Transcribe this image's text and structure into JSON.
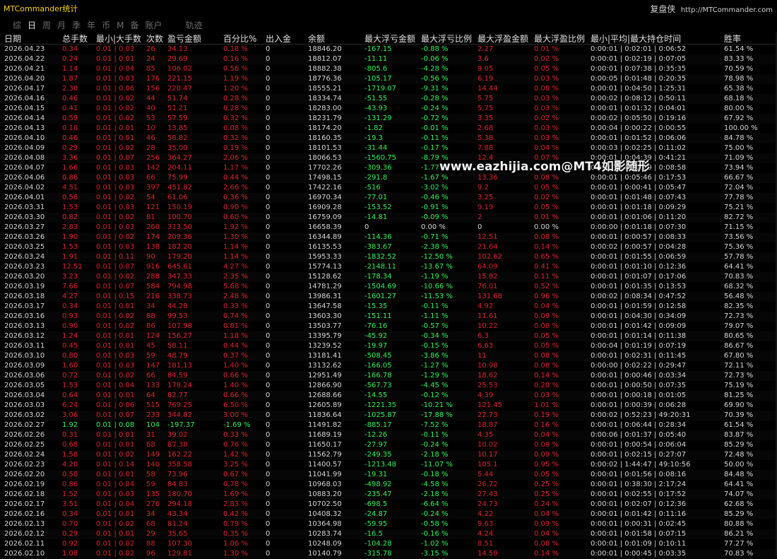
{
  "app": {
    "title": "MTCommander统计",
    "brand_cn": "复盘侠",
    "brand_url": "http://MTCommander.com"
  },
  "tabs": [
    "综",
    "日",
    "周",
    "月",
    "季",
    "年",
    "币",
    "M",
    "备",
    "账户",
    "轨迹"
  ],
  "active_tab": "日",
  "columns": [
    "日期",
    "总手数",
    "最小|大手数",
    "次数",
    "盈亏金额",
    "百分比%",
    "出入金",
    "余额",
    "最大浮亏金额",
    "最大浮亏比例",
    "最大浮盈金额",
    "最大浮盈比例",
    "最小|平均|最大持仓时间",
    "胜率"
  ],
  "watermark": "www.eazhijia.com@MT4如影随形",
  "colors": {
    "loss": "#e0202a",
    "profit": "#2ef25a",
    "neutral": "#d6d6d6"
  },
  "rows": [
    [
      "2026.04.23",
      "0.34",
      "0.01 | 0.03",
      "26",
      "34.13",
      "0.18 %",
      "0",
      "18846.20",
      "-167.15",
      "-0.88 %",
      "2.27",
      "0.01 %",
      "0:00:01 | 0:02:01 | 0:06:52",
      "61.54 %"
    ],
    [
      "2026.04.22",
      "0.24",
      "0.01 | 0.01",
      "24",
      "29.69",
      "0.16 %",
      "0",
      "18812.07",
      "-11.11",
      "-0.06 %",
      "3.6",
      "0.02 %",
      "0:00:01 | 0:02:19 | 0:07:05",
      "83.33 %"
    ],
    [
      "2026.04.21",
      "1.14",
      "0.01 | 0.04",
      "85",
      "106.02",
      "0.56 %",
      "0",
      "18882.38",
      "-805.6",
      "-4.28 %",
      "9.05",
      "0.05 %",
      "0:00:01 | 0:07:38 | 0:35:35",
      "70.59 %"
    ],
    [
      "2026.04.20",
      "1.87",
      "0.01 | 0.03",
      "176",
      "221.15",
      "1.19 %",
      "0",
      "18776.36",
      "-105.17",
      "-0.56 %",
      "6.19",
      "0.03 %",
      "0:00:05 | 0:01:48 | 0:20:35",
      "78.98 %"
    ],
    [
      "2026.04.17",
      "2.30",
      "0.01 | 0.06",
      "156",
      "220.47",
      "1.20 %",
      "0",
      "18555.21",
      "-1719.07",
      "-9.31 %",
      "14.44",
      "0.08 %",
      "0:00:01 | 0:04:50 | 1:25:31",
      "65.38 %"
    ],
    [
      "2026.04.16",
      "0.46",
      "0.01 | 0.02",
      "44",
      "51.74",
      "0.28 %",
      "0",
      "18334.74",
      "-51.55",
      "-0.28 %",
      "5.75",
      "0.03 %",
      "0:00:02 | 0:08:12 | 0:50:11",
      "68.18 %"
    ],
    [
      "2026.04.15",
      "0.41",
      "0.01 | 0.02",
      "40",
      "51.21",
      "0.28 %",
      "0",
      "18283.00",
      "-43.93",
      "-0.24 %",
      "5.75",
      "0.03 %",
      "0:00:01 | 0:01:32 | 0:04:01",
      "80.00 %"
    ],
    [
      "2026.04.14",
      "0.59",
      "0.01 | 0.02",
      "53",
      "57.59",
      "0.32 %",
      "0",
      "18231.79",
      "-131.29",
      "-0.72 %",
      "3.35",
      "0.02 %",
      "0:00:02 | 0:05:50 | 0:19:16",
      "67.92 %"
    ],
    [
      "2026.04.13",
      "0.10",
      "0.01 | 0.01",
      "10",
      "13.85",
      "0.08 %",
      "0",
      "18174.20",
      "-1.82",
      "-0.01 %",
      "2.68",
      "0.03 %",
      "0:00:04 | 0:00:22 | 0:00:55",
      "100.00 %"
    ],
    [
      "2026.04.10",
      "0.46",
      "0.01 | 0.01",
      "46",
      "58.82",
      "0.32 %",
      "0",
      "18160.35",
      "-19.3",
      "-0.11 %",
      "5.38",
      "0.03 %",
      "0:00:01 | 0:01:52 | 0:06:06",
      "84.78 %"
    ],
    [
      "2026.04.09",
      "0.29",
      "0.01 | 0.02",
      "28",
      "35.00",
      "0.19 %",
      "0",
      "18101.53",
      "-31.44",
      "-0.17 %",
      "7.88",
      "0.04 %",
      "0:00:03 | 0:02:25 | 0:11:02",
      "75.00 %"
    ],
    [
      "2026.04.08",
      "3.36",
      "0.01 | 0.07",
      "256",
      "364.27",
      "2.06 %",
      "0",
      "18066.53",
      "-1560.75",
      "-8.79 %",
      "12.4",
      "0.07 %",
      "0:00:01 | 0:04:39 | 0:41:21",
      "71.09 %"
    ],
    [
      "2026.04.07",
      "1.66",
      "0.01 | 0.03",
      "142",
      "204.11",
      "1.17 %",
      "0",
      "17702.26",
      "-309.36",
      "-1.77 %",
      "",
      "",
      "0:00:01 | 0:01:29 | 0:08:58",
      "73.94 %"
    ],
    [
      "2026.04.06",
      "0.86",
      "0.01 | 0.03",
      "66",
      "75.99",
      "0.44 %",
      "0",
      "17498.15",
      "-291.8",
      "-1.67 %",
      "13.36",
      "0.08 %",
      "0:00:01 | 0:05:46 | 0:17:53",
      "66.67 %"
    ],
    [
      "2026.04.02",
      "4.51",
      "0.01 | 0.03",
      "397",
      "451.82",
      "2.66 %",
      "0",
      "17422.16",
      "-516",
      "-3.02 %",
      "9.2",
      "0.05 %",
      "0:00:01 | 0:00:41 | 0:05:47",
      "72.04 %"
    ],
    [
      "2026.04.01",
      "0.58",
      "0.01 | 0.02",
      "54",
      "61.06",
      "0.36 %",
      "0",
      "16970.34",
      "-77.01",
      "-0.46 %",
      "3.25",
      "0.02 %",
      "0:00:01 | 0:01:48 | 0:07:43",
      "77.78 %"
    ],
    [
      "2026.03.31",
      "1.53",
      "0.01 | 0.03",
      "121",
      "150.19",
      "0.90 %",
      "0",
      "16909.28",
      "-153.52",
      "-0.91 %",
      "9.19",
      "0.05 %",
      "0:00:01 | 0:01:18 | 0:09:29",
      "75.21 %"
    ],
    [
      "2026.03.30",
      "0.82",
      "0.01 | 0.02",
      "81",
      "100.70",
      "0.60 %",
      "0",
      "16759.09",
      "-14.81",
      "-0.09 %",
      "2",
      "0.01 %",
      "0:00:01 | 0:01:06 | 0:11:20",
      "82.72 %"
    ],
    [
      "2026.03.27",
      "2.83",
      "0.01 | 0.03",
      "260",
      "313.50",
      "1.92 %",
      "0",
      "16658.39",
      "0",
      "0.00 %",
      "0",
      "0.00 %",
      "0:00:00 | 0:01:18 | 0:07:30",
      "71.15 %"
    ],
    [
      "2026.03.26",
      "1.90",
      "0.01 | 0.02",
      "174",
      "209.36",
      "1.30 %",
      "0",
      "16344.89",
      "-114.36",
      "-0.71 %",
      "12.51",
      "0.08 %",
      "0:00:01 | 0:00:57 | 0:08:33",
      "73.56 %"
    ],
    [
      "2026.03.25",
      "1.53",
      "0.01 | 0.03",
      "138",
      "182.20",
      "1.14 %",
      "0",
      "16135.53",
      "-383.67",
      "-2.38 %",
      "21.64",
      "0.14 %",
      "0:00:02 | 0:00:57 | 0:04:28",
      "75.36 %"
    ],
    [
      "2026.03.24",
      "1.91",
      "0.01 | 0.11",
      "90",
      "179.20",
      "1.14 %",
      "0",
      "15953.33",
      "-1832.52",
      "-12.50 %",
      "102.62",
      "0.65 %",
      "0:00:01 | 0:01:55 | 0:06:59",
      "57.78 %"
    ],
    [
      "2026.03.23",
      "12.51",
      "0.01 | 0.07",
      "916",
      "645.61",
      "4.27 %",
      "0",
      "15774.13",
      "-2148.11",
      "-13.67 %",
      "64.09",
      "0.41 %",
      "0:00:01 | 0:01:10 | 0:12:36",
      "64.41 %"
    ],
    [
      "2026.03.20",
      "3.23",
      "0.01 | 0.02",
      "288",
      "347.33",
      "2.35 %",
      "0",
      "15128.62",
      "-178.34",
      "-1.19 %",
      "15.82",
      "0.11 %",
      "0:00:01 | 0:01:07 | 0:17:06",
      "70.83 %"
    ],
    [
      "2026.03.19",
      "7.66",
      "0.01 | 0.07",
      "584",
      "794.98",
      "5.68 %",
      "0",
      "14781.29",
      "-1504.69",
      "-10.66 %",
      "76.01",
      "0.52 %",
      "0:00:01 | 0:01:35 | 0:13:53",
      "68.32 %"
    ],
    [
      "2026.03.18",
      "4.27",
      "0.01 | 0.15",
      "216",
      "338.73",
      "2.48 %",
      "0",
      "13986.31",
      "-1601.27",
      "-11.53 %",
      "131.68",
      "0.96 %",
      "0:00:02 | 0:08:34 | 0:47:52",
      "56.48 %"
    ],
    [
      "2026.03.17",
      "0.34",
      "0.01 | 0.01",
      "34",
      "44.28",
      "0.33 %",
      "0",
      "13647.58",
      "-15.35",
      "-0.11 %",
      "4.92",
      "0.04 %",
      "0:00:01 | 0:01:59 | 0:12:58",
      "82.35 %"
    ],
    [
      "2026.03.16",
      "0.93",
      "0.01 | 0.02",
      "88",
      "99.53",
      "0.74 %",
      "0",
      "13603.30",
      "-151.11",
      "-1.11 %",
      "11.61",
      "0.09 %",
      "0:00:01 | 0:04:30 | 0:34:09",
      "72.73 %"
    ],
    [
      "2026.03.13",
      "0.90",
      "0.01 | 0.02",
      "86",
      "107.98",
      "0.81 %",
      "0",
      "13503.77",
      "-76.16",
      "-0.57 %",
      "10.22",
      "0.08 %",
      "0:00:01 | 0:01:42 | 0:09:09",
      "79.07 %"
    ],
    [
      "2026.03.12",
      "1.24",
      "0.01 | 0.01",
      "124",
      "156.27",
      "1.18 %",
      "0",
      "13395.79",
      "-45.92",
      "-0.34 %",
      "6.3",
      "0.05 %",
      "0:00:01 | 0:01:14 | 0:11:38",
      "80.65 %"
    ],
    [
      "2026.03.11",
      "0.45",
      "0.01 | 0.01",
      "45",
      "58.11",
      "0.44 %",
      "0",
      "13239.52",
      "-19.97",
      "-0.15 %",
      "6.63",
      "0.05 %",
      "0:00:04 | 0:01:19 | 0:07:19",
      "86.67 %"
    ],
    [
      "2026.03.10",
      "0.80",
      "0.01 | 0.03",
      "59",
      "48.79",
      "0.37 %",
      "0",
      "13181.41",
      "-508.45",
      "-3.86 %",
      "11",
      "0.08 %",
      "0:00:01 | 0:02:31 | 0:11:45",
      "67.80 %"
    ],
    [
      "2026.03.09",
      "1.60",
      "0.01 | 0.03",
      "147",
      "181.13",
      "1.40 %",
      "0",
      "13132.62",
      "-166.05",
      "-1.27 %",
      "10.98",
      "0.08 %",
      "0:00:00 | 0:02:22 | 0:29:47",
      "72.11 %"
    ],
    [
      "2026.03.06",
      "0.72",
      "0.01 | 0.02",
      "66",
      "84.59",
      "0.66 %",
      "0",
      "12951.49",
      "-166.78",
      "-1.29 %",
      "18.62",
      "0.14 %",
      "0:00:01 | 0:00:46 | 0:03:34",
      "72.73 %"
    ],
    [
      "2026.03.05",
      "1.53",
      "0.01 | 0.04",
      "133",
      "178.24",
      "1.40 %",
      "0",
      "12866.90",
      "-567.73",
      "-4.45 %",
      "25.53",
      "0.20 %",
      "0:00:01 | 0:00:50 | 0:07:35",
      "75.19 %"
    ],
    [
      "2026.03.04",
      "0.64",
      "0.01 | 0.01",
      "64",
      "82.77",
      "0.66 %",
      "0",
      "12688.66",
      "-14.55",
      "-0.12 %",
      "4.39",
      "0.03 %",
      "0:00:01 | 0:00:18 | 0:01:05",
      "81.25 %"
    ],
    [
      "2026.03.03",
      "6.24",
      "0.01 | 0.06",
      "515",
      "769.25",
      "6.50 %",
      "0",
      "12605.89",
      "-1221.35",
      "-10.21 %",
      "121.45",
      "1.01 %",
      "0:00:01 | 0:00:39 | 0:06:28",
      "69.90 %"
    ],
    [
      "2026.03.02",
      "3.06",
      "0.01 | 0.07",
      "233",
      "344.82",
      "3.00 %",
      "0",
      "11836.64",
      "-1025.87",
      "-17.88 %",
      "22.73",
      "0.19 %",
      "0:00:02 | 0:52:23 | 49:20:31",
      "70.39 %"
    ],
    [
      "2026.02.27",
      "1.92",
      "0.01 | 0.08",
      "104",
      "-197.37",
      "-1.69 %",
      "0",
      "11491.82",
      "-885.17",
      "-7.52 %",
      "18.87",
      "0.16 %",
      "0:00:01 | 0:06:44 | 0:28:34",
      "61.54 %"
    ],
    [
      "2026.02.26",
      "0.31",
      "0.01 | 0.01",
      "31",
      "39.02",
      "0.33 %",
      "0",
      "11689.19",
      "-12.26",
      "-0.11 %",
      "4.35",
      "0.04 %",
      "0:00:06 | 0:01:37 | 0:05:40",
      "83.87 %"
    ],
    [
      "2026.02.25",
      "0.68",
      "0.01 | 0.01",
      "68",
      "87.38",
      "0.76 %",
      "0",
      "11650.17",
      "-27.97",
      "-0.24 %",
      "10.02",
      "0.09 %",
      "0:00:01 | 0:00:54 | 0:06:04",
      "85.29 %"
    ],
    [
      "2026.02.24",
      "1.58",
      "0.01 | 0.02",
      "149",
      "162.22",
      "1.42 %",
      "0",
      "11562.79",
      "-249.35",
      "-2.18 %",
      "10.17",
      "0.09 %",
      "0:00:01 | 0:02:15 | 0:27:07",
      "72.48 %"
    ],
    [
      "2026.02.23",
      "4.20",
      "0.01 | 0.14",
      "140",
      "358.58",
      "3.25 %",
      "0",
      "11400.57",
      "-1213.48",
      "-11.07 %",
      "105.1",
      "0.95 %",
      "0:00:02 | 1:44:47 | 49:10:56",
      "50.00 %"
    ],
    [
      "2026.02.20",
      "0.58",
      "0.01 | 0.01",
      "58",
      "73.96",
      "0.67 %",
      "0",
      "11041.99",
      "-19.31",
      "-0.18 %",
      "5.44",
      "0.05 %",
      "0:00:01 | 0:01:56 | 0:08:16",
      "84.48 %"
    ],
    [
      "2026.02.19",
      "0.86",
      "0.01 | 0.04",
      "59",
      "84.83",
      "0.78 %",
      "0",
      "10968.03",
      "-498.92",
      "-4.58 %",
      "26.72",
      "0.25 %",
      "0:00:01 | 0:38:30 | 2:17:24",
      "64.41 %"
    ],
    [
      "2026.02.18",
      "1.52",
      "0.01 | 0.03",
      "135",
      "180.70",
      "1.69 %",
      "0",
      "10883.20",
      "-235.47",
      "-2.18 %",
      "27.43",
      "0.25 %",
      "0:00:01 | 0:02:55 | 0:17:52",
      "74.07 %"
    ],
    [
      "2026.02.17",
      "3.51",
      "0.01 | 0.04",
      "276",
      "294.18",
      "2.83 %",
      "0",
      "10702.50",
      "-698.5",
      "-6.64 %",
      "24.73",
      "0.24 %",
      "0:00:01 | 0:02:07 | 0:12:36",
      "62.68 %"
    ],
    [
      "2026.02.16",
      "0.34",
      "0.01 | 0.01",
      "34",
      "43.34",
      "0.42 %",
      "0",
      "10408.32",
      "-24.87",
      "-0.24 %",
      "4.22",
      "0.04 %",
      "0:00:01 | 0:01:42 | 0:11:16",
      "85.29 %"
    ],
    [
      "2026.02.13",
      "0.70",
      "0.01 | 0.02",
      "68",
      "81.24",
      "0.79 %",
      "0",
      "10364.98",
      "-59.95",
      "-0.58 %",
      "9.63",
      "0.09 %",
      "0:00:01 | 0:00:31 | 0:02:45",
      "80.88 %"
    ],
    [
      "2026.02.12",
      "0.29",
      "0.01 | 0.01",
      "29",
      "35.65",
      "0.35 %",
      "0",
      "10283.74",
      "-16.5",
      "-0.16 %",
      "4.24",
      "0.04 %",
      "0:00:01 | 0:01:58 | 0:07:15",
      "86.21 %"
    ],
    [
      "2026.02.11",
      "0.92",
      "0.01 | 0.02",
      "88",
      "107.30",
      "1.06 %",
      "0",
      "10248.09",
      "-104.28",
      "-1.02 %",
      "8.51",
      "0.08 %",
      "0:00:01 | 0:01:09 | 0:10:11",
      "77.27 %"
    ],
    [
      "2026.02.10",
      "1.08",
      "0.01 | 0.02",
      "96",
      "129.81",
      "1.30 %",
      "0",
      "10140.79",
      "-315.78",
      "-3.15 %",
      "14.59",
      "0.14 %",
      "0:00:01 | 0:00:45 | 0:03:35",
      "70.83 %"
    ]
  ]
}
